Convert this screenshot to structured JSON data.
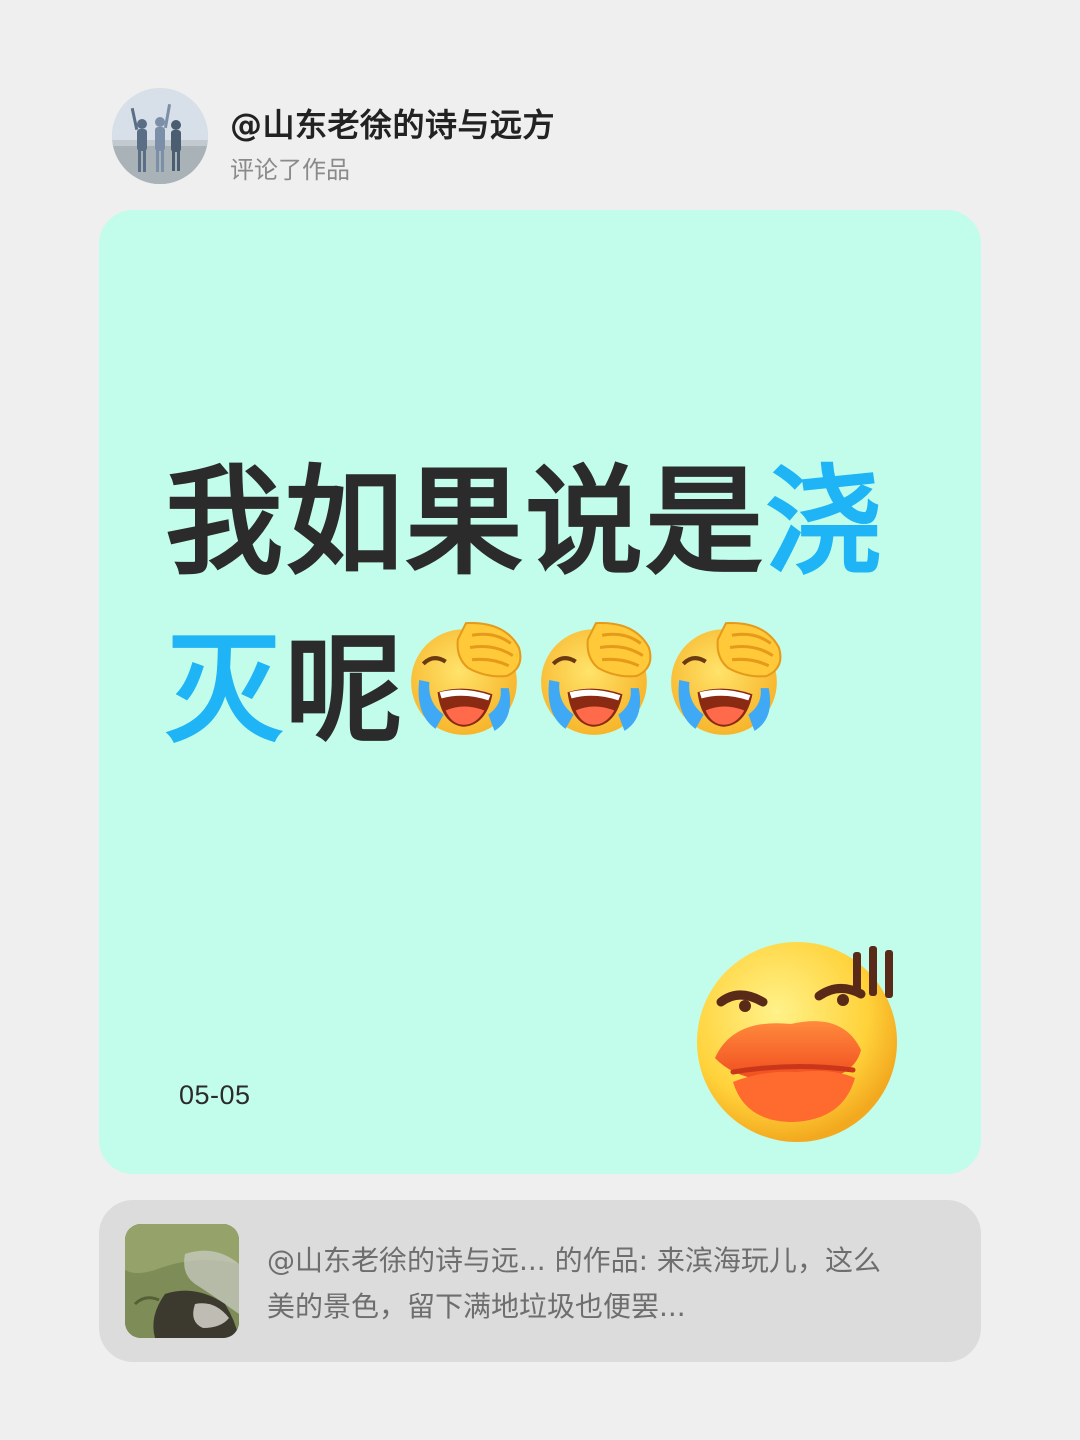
{
  "header": {
    "author": "@山东老徐的诗与远方",
    "action": "评论了作品",
    "avatar_icon": "avatar-photo-icon"
  },
  "card": {
    "background": "#c2fcea",
    "comment_line1_prefix": "我如果说是",
    "comment_line1_highlight": "浇",
    "comment_line2_highlight": "灭",
    "comment_line2_suffix": "呢",
    "highlight_color": "#1eb4f5",
    "inline_emoji_icon": "facepalm-laughing-crying-emoji",
    "inline_emoji_count": 3,
    "date": "05-05",
    "sticker_icon": "duck-lips-sweat-emoji"
  },
  "reference": {
    "line1": "@山东老徐的诗与远... 的作品: 来滨海玩儿，这么",
    "line2": "美的景色，留下满地垃圾也便罢...",
    "thumb_icon": "grass-smoke-thumbnail"
  }
}
